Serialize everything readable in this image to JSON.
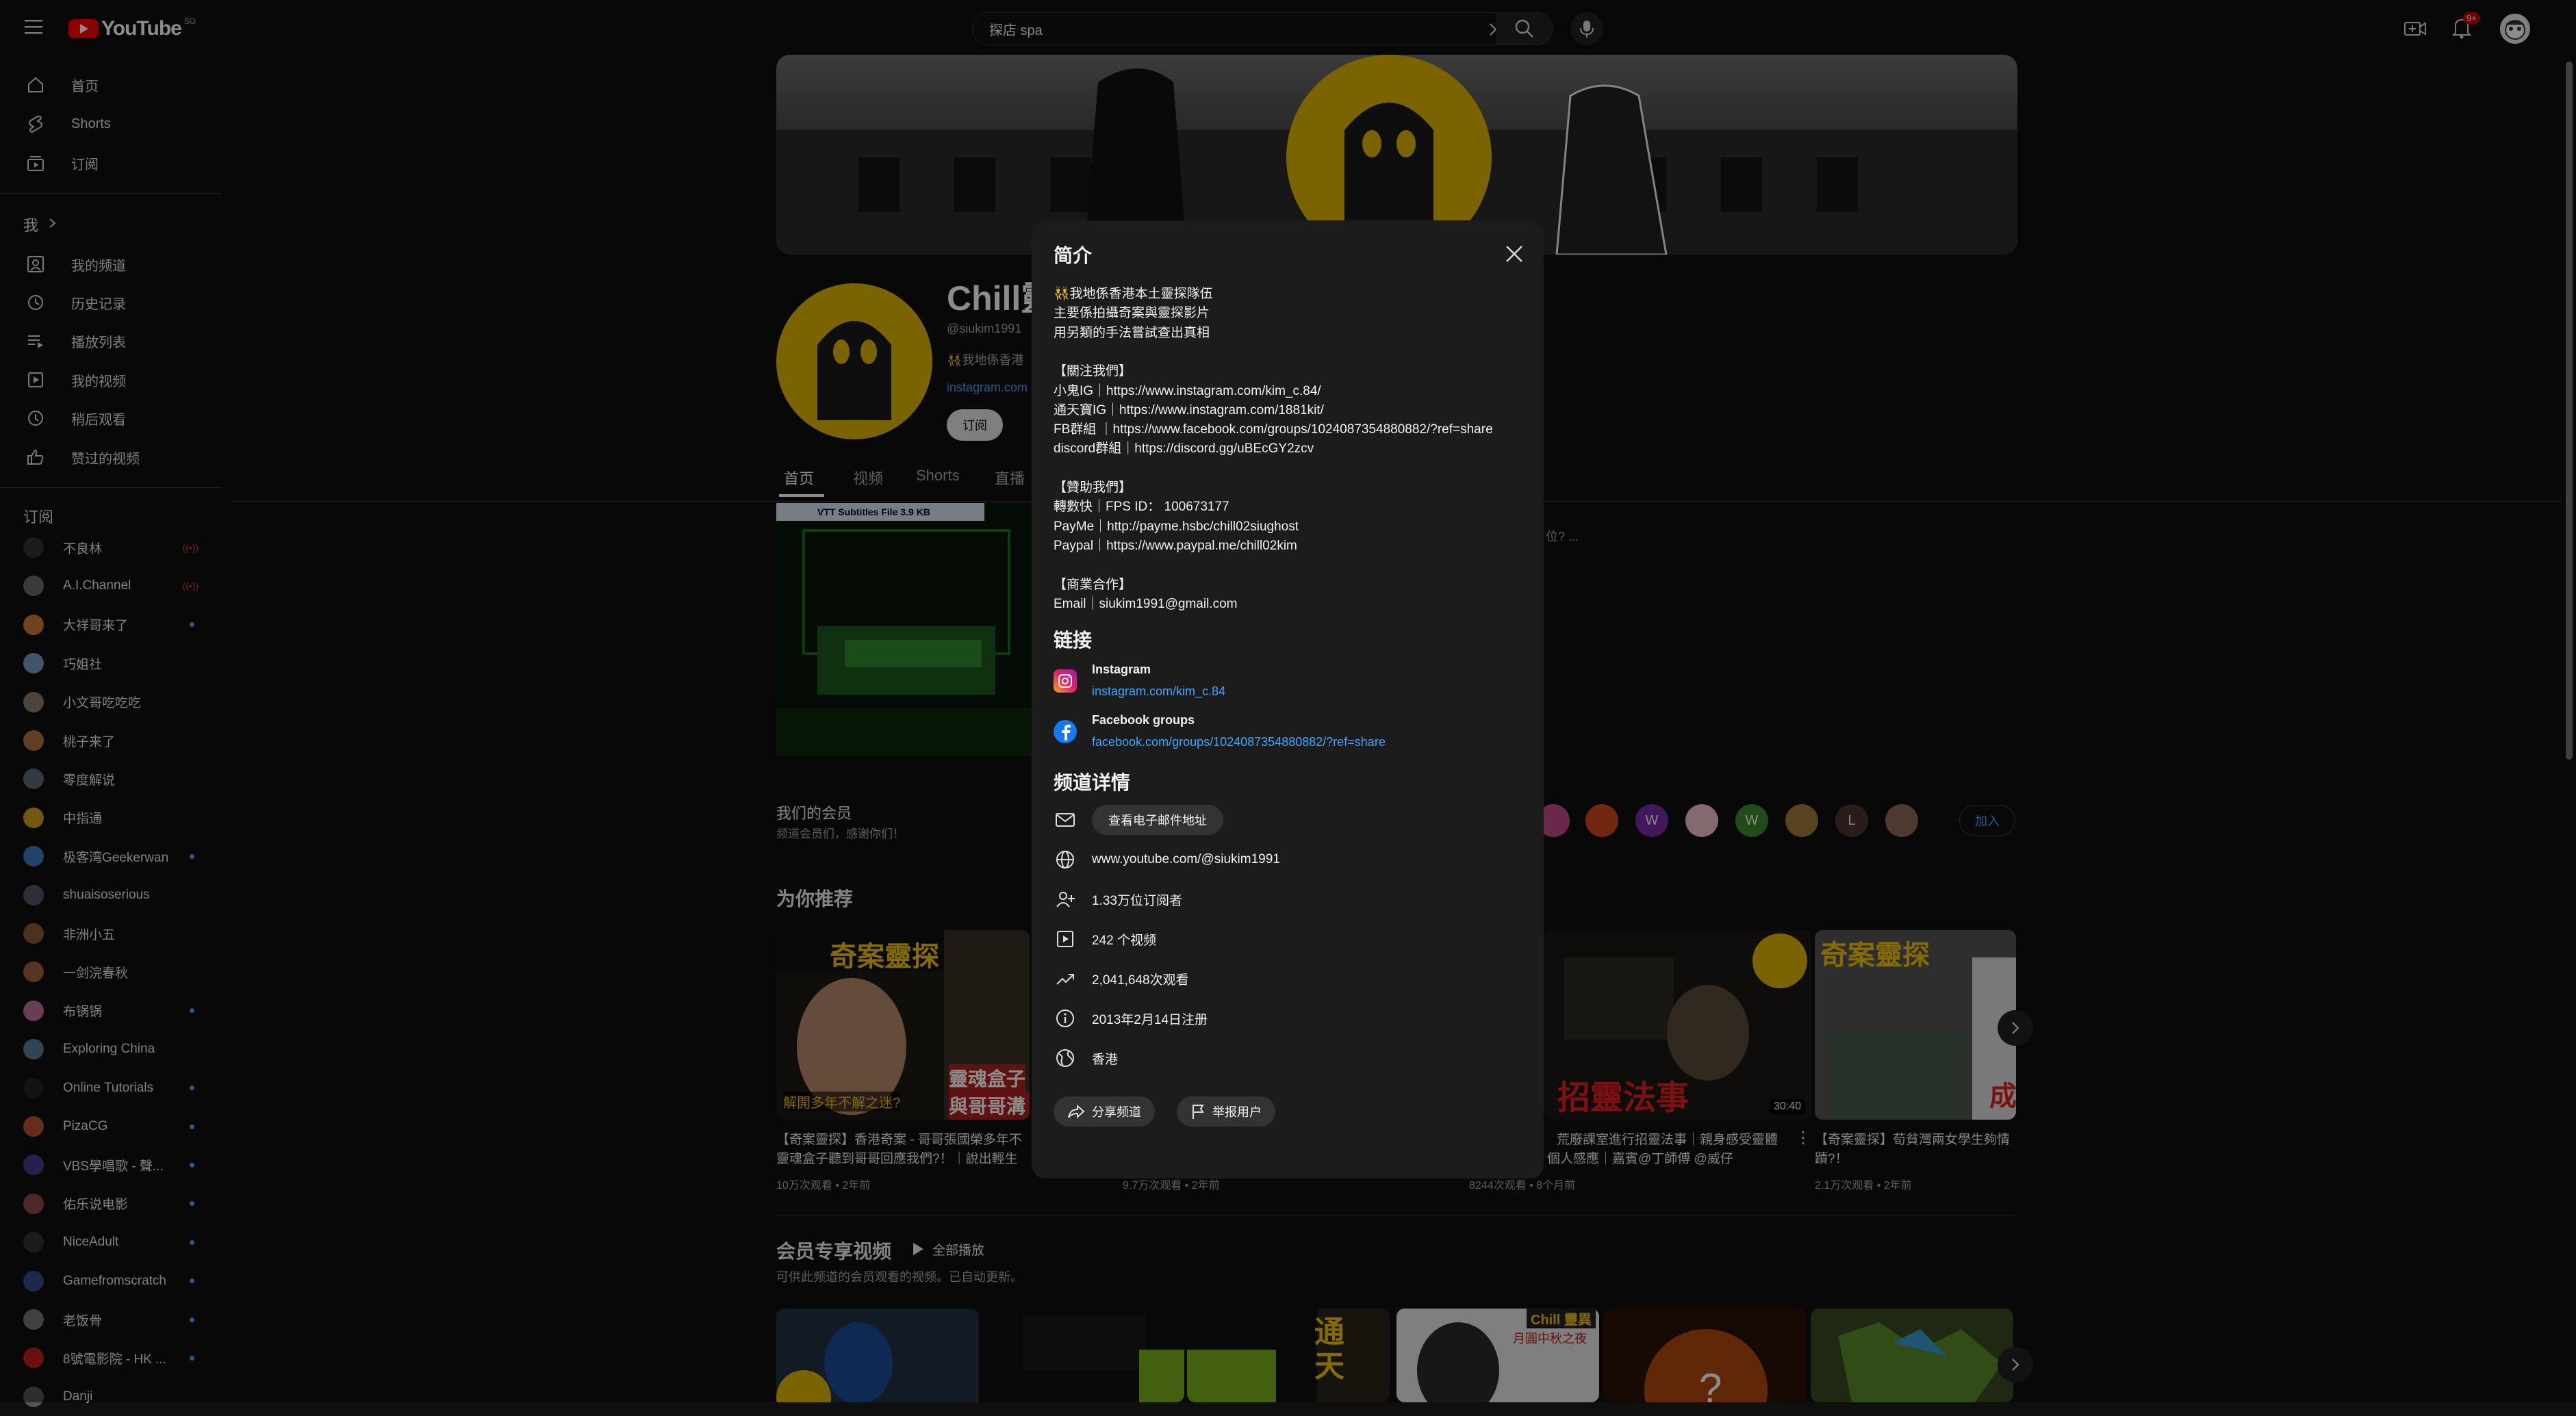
{
  "topbar": {
    "logo_text": "YouTube",
    "region_badge": "SG",
    "search_value": "探店 spa",
    "notifications_count": "9+"
  },
  "sidebar": {
    "main": [
      {
        "label": "首页",
        "icon": "home-icon"
      },
      {
        "label": "Shorts",
        "icon": "shorts-icon"
      },
      {
        "label": "订阅",
        "icon": "subscriptions-icon"
      }
    ],
    "me_header": "我",
    "me": [
      {
        "label": "我的频道",
        "icon": "channel-icon"
      },
      {
        "label": "历史记录",
        "icon": "history-icon"
      },
      {
        "label": "播放列表",
        "icon": "playlist-icon"
      },
      {
        "label": "我的视频",
        "icon": "my-videos-icon"
      },
      {
        "label": "稍后观看",
        "icon": "watch-later-icon"
      },
      {
        "label": "赞过的视频",
        "icon": "like-icon"
      }
    ],
    "subs_header": "订阅",
    "subscriptions": [
      {
        "label": "不良林",
        "status": "live"
      },
      {
        "label": "A.I.Channel",
        "status": "live"
      },
      {
        "label": "大祥哥来了",
        "status": "dot"
      },
      {
        "label": "巧姐社",
        "status": ""
      },
      {
        "label": "小文哥吃吃吃",
        "status": ""
      },
      {
        "label": "桃子来了",
        "status": ""
      },
      {
        "label": "零度解说",
        "status": ""
      },
      {
        "label": "中指通",
        "status": ""
      },
      {
        "label": "极客湾Geekerwan",
        "status": "dot"
      },
      {
        "label": "shuaisoserious",
        "status": ""
      },
      {
        "label": "非洲小五",
        "status": ""
      },
      {
        "label": "一剑浣春秋",
        "status": ""
      },
      {
        "label": "布锅锅",
        "status": "dot"
      },
      {
        "label": "Exploring China",
        "status": ""
      },
      {
        "label": "Online Tutorials",
        "status": "dot"
      },
      {
        "label": "PizaCG",
        "status": "dot"
      },
      {
        "label": "VBS學唱歌 - 聲...",
        "status": "dot"
      },
      {
        "label": "佑乐说电影",
        "status": "dot"
      },
      {
        "label": "NiceAdult",
        "status": "dot"
      },
      {
        "label": "Gamefromscratch",
        "status": "dot"
      },
      {
        "label": "老饭骨",
        "status": "dot"
      },
      {
        "label": "8號電影院 - HK ...",
        "status": "dot"
      },
      {
        "label": "Danji",
        "status": ""
      }
    ],
    "colors": {
      "live": "#e53935",
      "dot": "#3ea6ff"
    }
  },
  "channel": {
    "name": "Chill靈",
    "handle": "@siukim1991",
    "desc_snippet": "👯我地係香港",
    "link_snippet": "instagram.com",
    "subscribe_label": "订阅",
    "tabs": [
      "首页",
      "视频",
      "Shorts",
      "直播"
    ],
    "featured_overlay": "VTT Subtitles File 3.9 KB",
    "featured_desc_tail": "位? ...",
    "members_title": "我们的会员",
    "members_sub": "频道会员们，感谢你们！",
    "join_label": "加入",
    "member_avatars": [
      "",
      "",
      "W",
      "",
      "W",
      "",
      "L",
      ""
    ],
    "recommended_title": "为你推荐",
    "recommended": [
      {
        "title_line1": "【奇案靈探】香港奇案 - 哥哥張國榮多年不",
        "title_line2": "靈魂盒子聽到哥哥回應我們?！｜說出輕生",
        "meta": "10万次观看 • 2年前"
      },
      {
        "title_line1": "",
        "title_line2": "",
        "meta": "9.7万次观看 • 2年前"
      },
      {
        "title_line1": "荒廢課室進行招靈法事｜親身感受靈體",
        "title_line2": "個人感應｜嘉賓@丁師傅 @威仔",
        "meta": "8244次观看 • 8个月前",
        "duration": "30:40"
      },
      {
        "title_line1": "【奇案靈探】荀貧灣兩女學生夠情",
        "title_line2": "蹟?！",
        "meta": "2.1万次观看 • 2年前"
      }
    ],
    "thumb_texts": [
      "奇案靈探",
      "解開多年不解之迷?",
      "靈魂盒子",
      "與哥哥溝通",
      "招靈法事",
      "奇案靈探",
      "成"
    ],
    "members_videos_title": "会员专享视频",
    "play_all_label": "全部播放",
    "members_videos_sub": "可供此频道的会员观看的视频。已自动更新。",
    "member_thumb_texts": [
      "通天",
      "Chill 靈異",
      "月圓中秋之夜"
    ]
  },
  "about": {
    "title": "简介",
    "description": [
      "👯我地係香港本土靈探隊伍",
      "主要係拍攝奇案與靈探影片",
      "用另類的手法嘗試查出真相",
      "",
      "【關注我們】",
      "小鬼IG｜https://www.instagram.com/kim_c.84/",
      "通天寶IG｜https://www.instagram.com/1881kit/",
      "FB群組 ｜https://www.facebook.com/groups/1024087354880882/?ref=share",
      "discord群組｜https://discord.gg/uBEcGY2zcv",
      "",
      "【贊助我們】",
      "轉數快｜FPS ID： 100673177",
      "PayMe｜http://payme.hsbc/chill02siughost",
      "Paypal｜https://www.paypal.me/chill02kim",
      "",
      "【商業合作】",
      "Email｜siukim1991@gmail.com"
    ],
    "links_title": "链接",
    "links": [
      {
        "name": "Instagram",
        "url": "instagram.com/kim_c.84",
        "icon": "instagram-icon"
      },
      {
        "name": "Facebook groups",
        "url": "facebook.com/groups/1024087354880882/?ref=share",
        "icon": "facebook-icon"
      }
    ],
    "details_title": "频道详情",
    "email_button": "查看电子邮件地址",
    "website": "www.youtube.com/@siukim1991",
    "subscribers": "1.33万位订阅者",
    "videos": "242 个视频",
    "views": "2,041,648次观看",
    "joined": "2013年2月14日注册",
    "location": "香港",
    "share_label": "分享频道",
    "report_label": "举报用户",
    "link_color": "#3ea6ff"
  }
}
